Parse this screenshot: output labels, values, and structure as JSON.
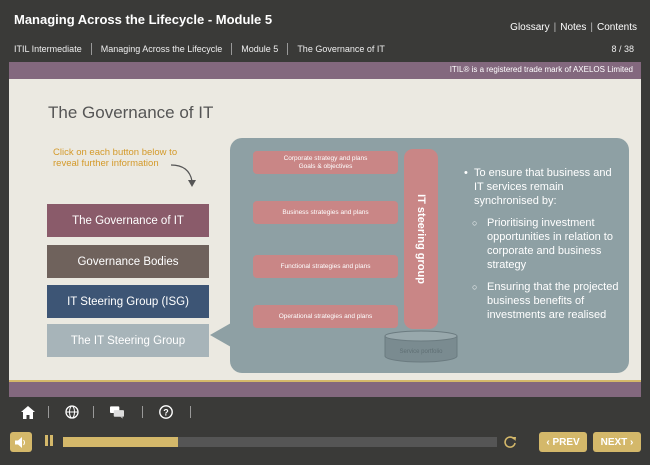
{
  "header": {
    "title": "Managing Across the Lifecycle - Module 5",
    "links": [
      "Glossary",
      "Notes",
      "Contents"
    ],
    "breadcrumbs": [
      "ITIL Intermediate",
      "Managing Across the Lifecycle",
      "Module 5",
      "The Governance of IT"
    ],
    "page_indicator": "8 / 38"
  },
  "trademark": "ITIL® is a registered trade mark of AXELOS Limited",
  "content": {
    "title": "The Governance of IT",
    "instruction": "Click on each button below to reveal further information",
    "buttons": [
      {
        "label": "The Governance of IT",
        "color": "#8a5b6a"
      },
      {
        "label": "Governance Bodies",
        "color": "#6f625c"
      },
      {
        "label": "IT Steering Group (ISG)",
        "color": "#3d5575"
      },
      {
        "label": "The IT Steering Group",
        "color": "#a7b4b9"
      }
    ],
    "diagram": {
      "strategies": [
        {
          "line1": "Corporate strategy and plans",
          "line2": "Goals & objectives"
        },
        {
          "line1": "Business strategies and plans",
          "line2": ""
        },
        {
          "line1": "Functional strategies and plans",
          "line2": ""
        },
        {
          "line1": "Operational strategies and plans",
          "line2": ""
        }
      ],
      "steering_label": "IT steering group",
      "cylinder_label": "Service portfolio"
    },
    "bullets": {
      "main": "To ensure that business and IT services remain synchronised by:",
      "subs": [
        "Prioritising investment opportunities in relation to corporate and business strategy",
        "Ensuring that the projected business benefits of investments are realised"
      ]
    }
  },
  "nav_icons": [
    "home-icon",
    "globe-icon",
    "chat-icon",
    "help-icon"
  ],
  "player": {
    "progress": 0.265,
    "prev_label": "PREV",
    "next_label": "NEXT",
    "accent_color": "#d4b86a"
  }
}
